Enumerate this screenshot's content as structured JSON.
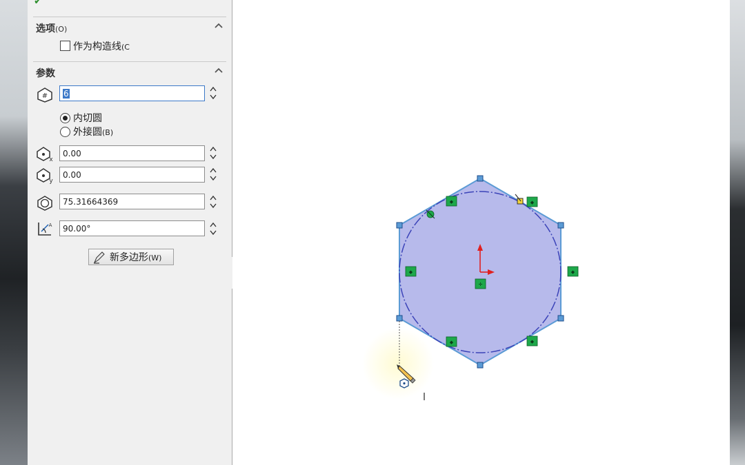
{
  "options_section": {
    "title": "选项",
    "title_key": "(O)",
    "construction_label": "作为构造线",
    "construction_key": "(C"
  },
  "params_section": {
    "title": "参数"
  },
  "sides_field": {
    "value": "6"
  },
  "mode": {
    "inscribed_label": "内切圆",
    "circumscribed_label": "外接圆",
    "circumscribed_key": "(B)"
  },
  "center_x_field": {
    "value": "0.00"
  },
  "center_y_field": {
    "value": "0.00"
  },
  "diameter_field": {
    "value": "75.31664369"
  },
  "angle_field": {
    "value": "90.00°"
  },
  "new_polygon_button": {
    "label": "新多边形",
    "key": "(W)"
  },
  "colors": {
    "polygon_fill": "#b3b6ea",
    "polygon_edge": "#5b9bd5",
    "circle": "#3b43b8",
    "relation_badge": "#1ea84a",
    "axis_red": "#e02020"
  }
}
